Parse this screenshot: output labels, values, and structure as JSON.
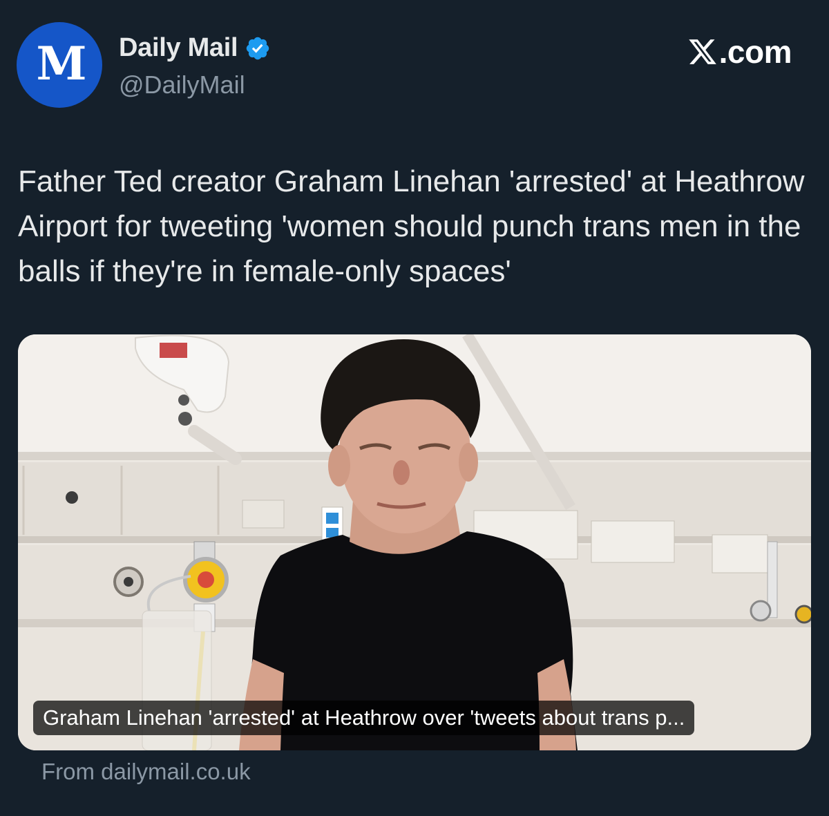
{
  "author": {
    "display_name": "Daily Mail",
    "handle": "@DailyMail",
    "verified": true,
    "avatar_glyph": "M"
  },
  "branding": {
    "domain": ".com",
    "logo_icon": "x-logo-icon"
  },
  "tweet": {
    "text": "Father Ted creator Graham Linehan 'arrested' at Heathrow Airport for tweeting 'women should punch trans men in the balls if they're in female-only spaces'"
  },
  "link_card": {
    "caption": "Graham Linehan 'arrested' at Heathrow over 'tweets about trans p...",
    "source": "From dailymail.co.uk"
  },
  "colors": {
    "background": "#15202b",
    "avatar": "#1556c8",
    "verified_badge": "#1d9bf0",
    "secondary_text": "#8b98a5"
  }
}
